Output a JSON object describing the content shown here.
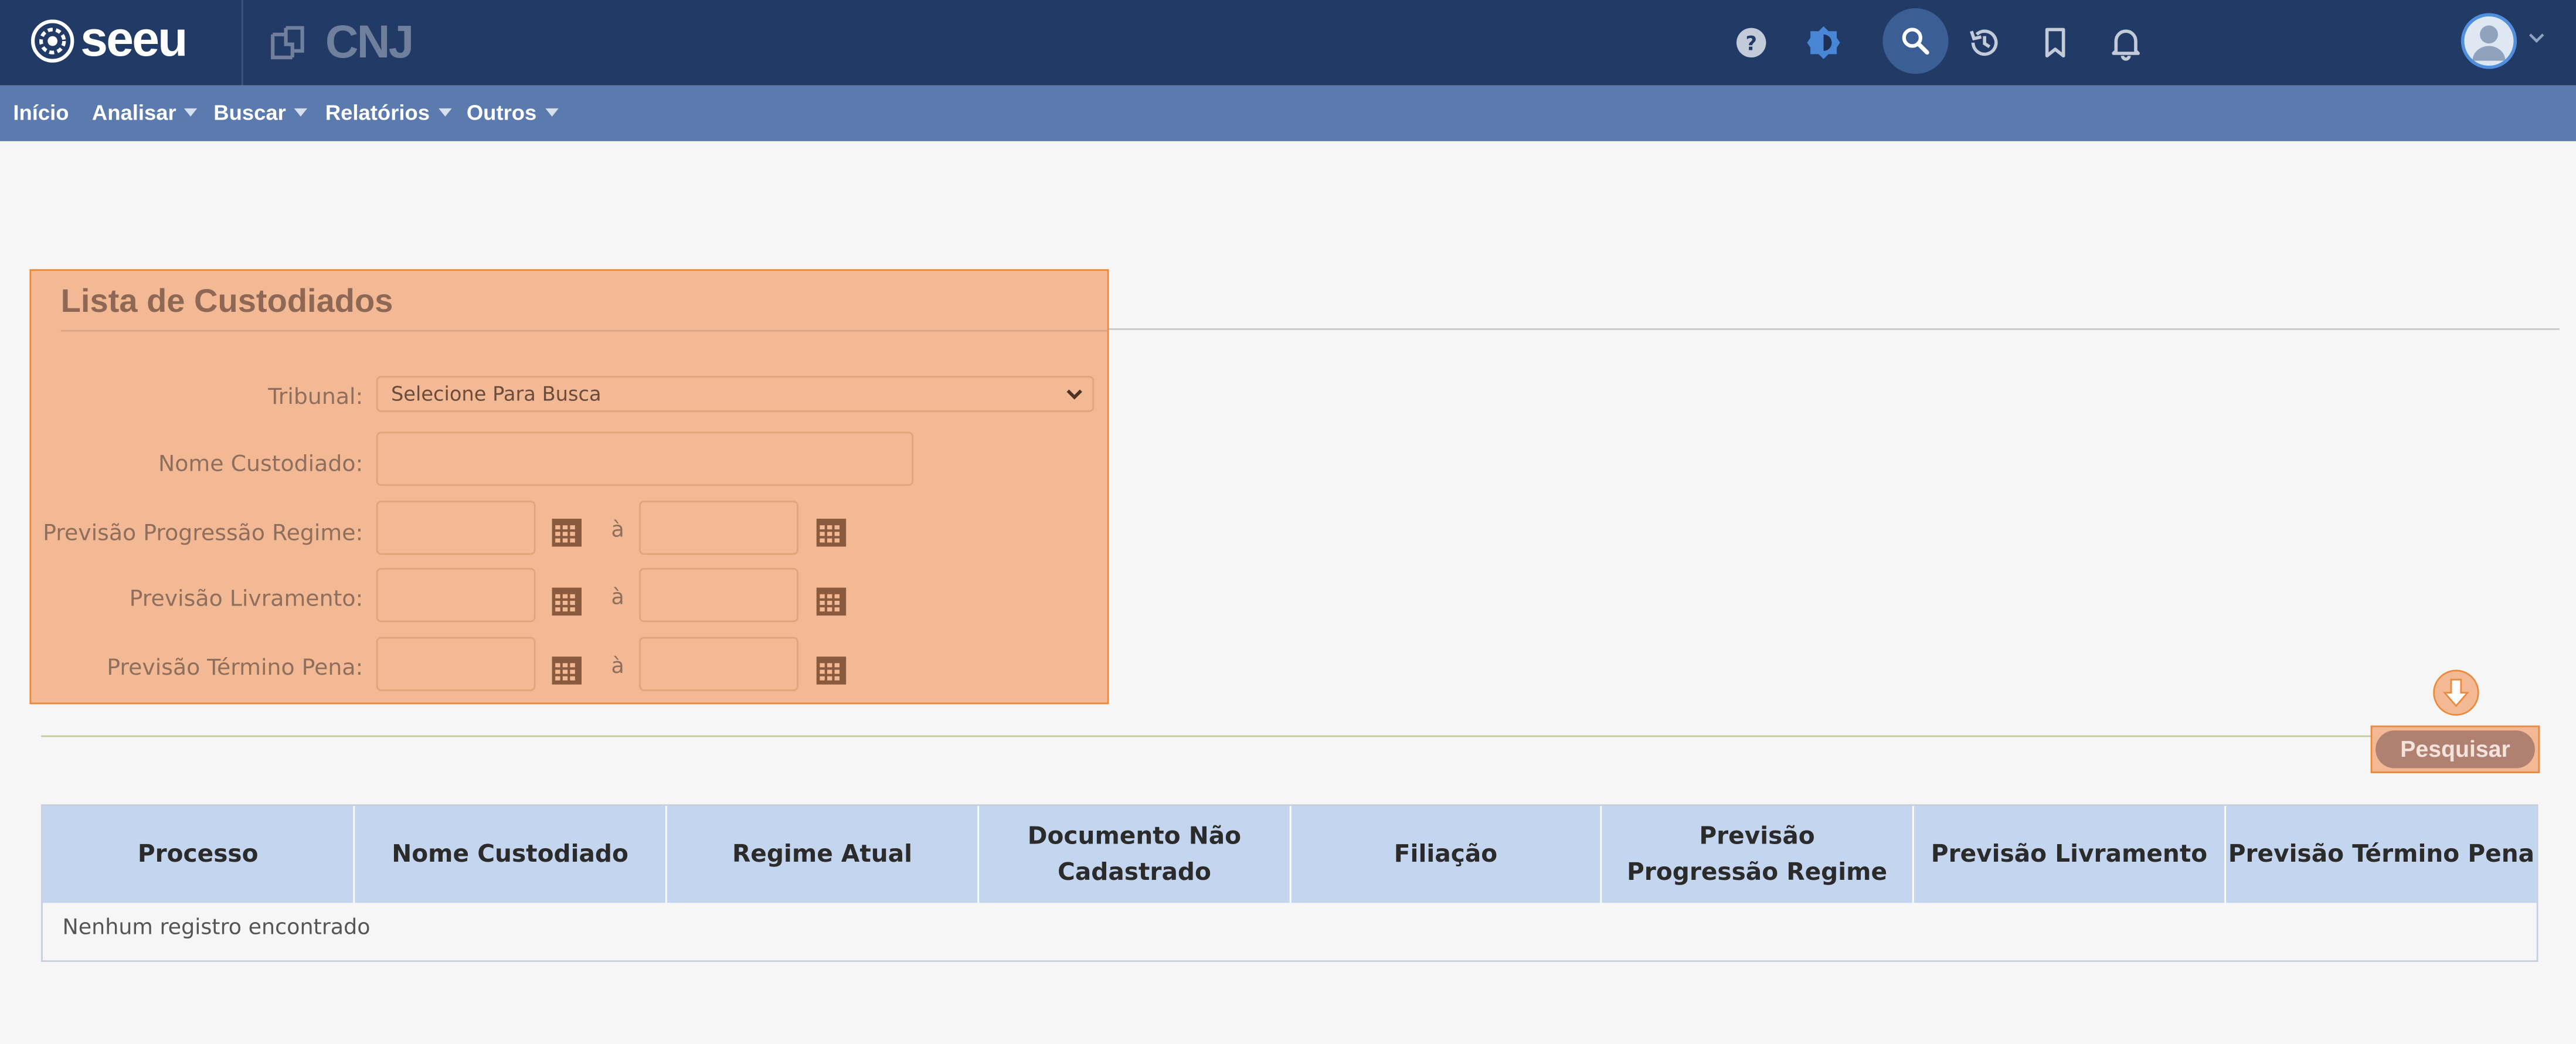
{
  "header": {
    "logo_text": "seeu",
    "cnj_text": "CNJ",
    "icons": [
      "help-icon",
      "theme-icon",
      "search-icon",
      "history-icon",
      "bookmark-icon",
      "bell-icon",
      "avatar-icon"
    ]
  },
  "menu": {
    "items": [
      {
        "label": "Início",
        "has_caret": false
      },
      {
        "label": "Analisar",
        "has_caret": true
      },
      {
        "label": "Buscar",
        "has_caret": true
      },
      {
        "label": "Relatórios",
        "has_caret": true
      },
      {
        "label": "Outros",
        "has_caret": true
      }
    ]
  },
  "form": {
    "title": "Lista de Custodiados",
    "tribunal_label": "Tribunal:",
    "tribunal_value": "Selecione Para Busca",
    "nome_label": "Nome Custodiado:",
    "nome_value": "",
    "progressao_label": "Previsão Progressão Regime:",
    "livramento_label": "Previsão Livramento:",
    "termino_label": "Previsão Término Pena:",
    "range_sep": "à",
    "date_values": {
      "progressao_from": "",
      "progressao_to": "",
      "livramento_from": "",
      "livramento_to": "",
      "termino_from": "",
      "termino_to": ""
    }
  },
  "search_button": "Pesquisar",
  "table": {
    "headers": [
      "Processo",
      "Nome Custodiado",
      "Regime Atual",
      "Documento Não Cadastrado",
      "Filiação",
      "Previsão Progressão Regime",
      "Previsão Livramento",
      "Previsão Término Pena"
    ],
    "rows": [],
    "empty_message": "Nenhum registro encontrado"
  },
  "colors": {
    "topbar": "#223a66",
    "menubar": "#5b7aad",
    "highlight_fill": "#f2b994",
    "highlight_border": "#ec8a3b",
    "table_header": "#c4d6ef"
  }
}
